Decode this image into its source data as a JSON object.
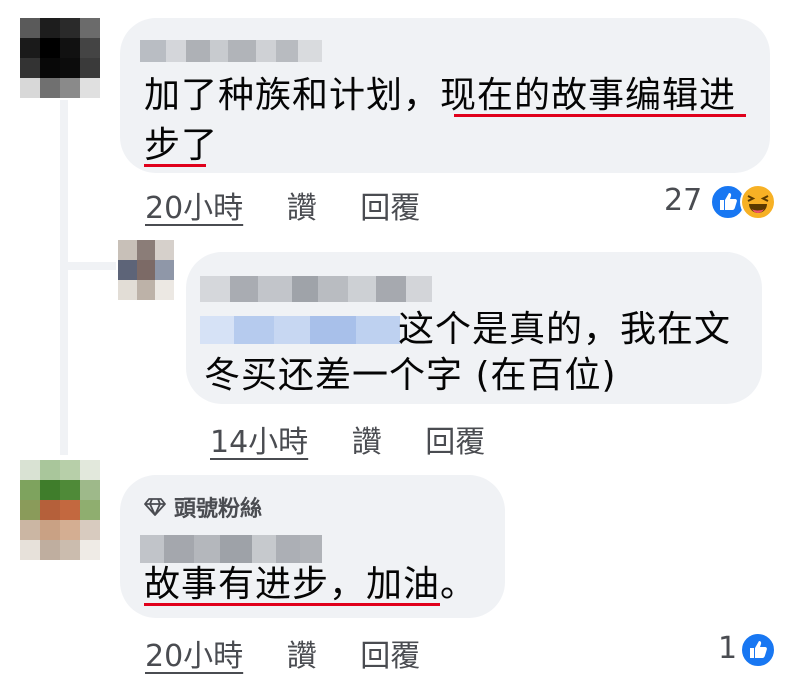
{
  "comments": [
    {
      "text_line1": "加了种族和计划，现在的故事编辑进",
      "text_line2": "步了",
      "time": "20小時",
      "like": "讚",
      "reply": "回覆",
      "reaction_count": "27",
      "reactions": [
        "like-icon",
        "haha-icon"
      ]
    },
    {
      "text_line1": "这个是真的，我在文",
      "text_line2": "冬买还差一个字 (在百位)",
      "time": "14小時",
      "like": "讚",
      "reply": "回覆"
    },
    {
      "badge": "頭號粉絲",
      "badge_icon": "diamond-icon",
      "text_line1": "故事有进步，加油。",
      "time": "20小時",
      "like": "讚",
      "reply": "回覆",
      "reaction_count": "1",
      "reactions": [
        "like-icon"
      ]
    }
  ],
  "colors": {
    "bubble": "#f0f2f5",
    "underline": "#e0001b",
    "like": "#1877f2",
    "meta": "#4a4c51"
  }
}
